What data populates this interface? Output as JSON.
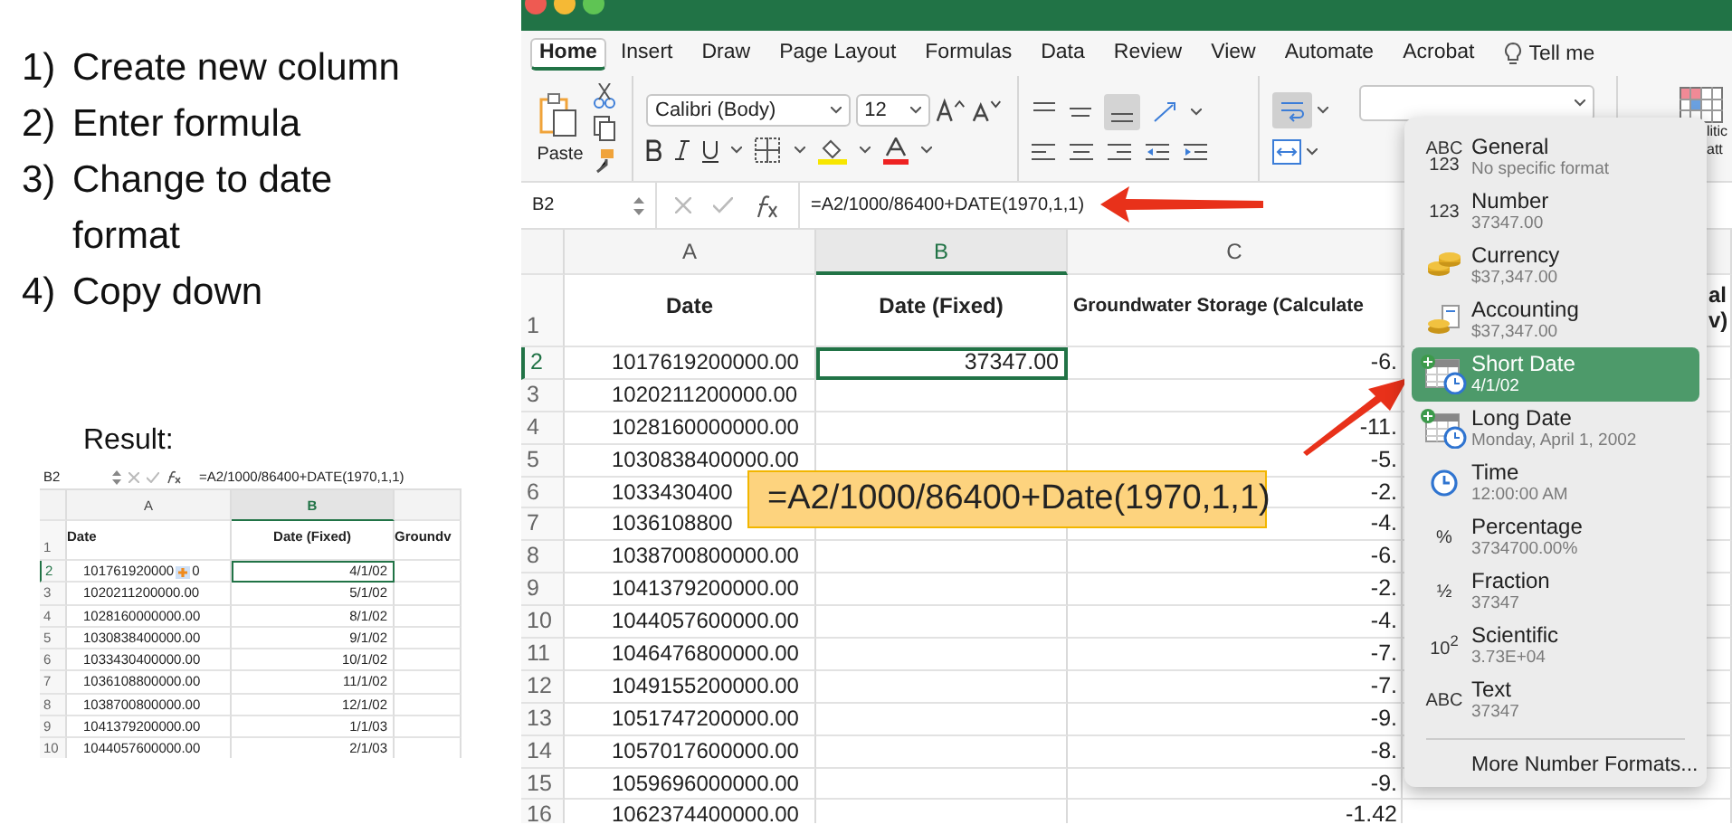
{
  "steps": [
    {
      "number": "1)",
      "text": "Create new column"
    },
    {
      "number": "2)",
      "text": "Enter formula"
    },
    {
      "number": "3)",
      "text": "Change to date format"
    },
    {
      "number": "4)",
      "text": "Copy down"
    }
  ],
  "result_label": "Result:",
  "result_sheet": {
    "name_box": "B2",
    "formula": "=A2/1000/86400+DATE(1970,1,1)",
    "columns": [
      {
        "label": "A",
        "selected": false
      },
      {
        "label": "B",
        "selected": true
      }
    ],
    "header_row": {
      "row": "1",
      "cells": [
        "Date",
        "Date (Fixed)",
        "Groundv"
      ]
    },
    "rows": [
      {
        "row": "2",
        "a": "101761920000",
        "a_tail": "0",
        "b": "4/1/02",
        "selected": true
      },
      {
        "row": "3",
        "a": "1020211200000.00",
        "b": "5/1/02",
        "selected": false
      },
      {
        "row": "4",
        "a": "1028160000000.00",
        "b": "8/1/02",
        "selected": false
      },
      {
        "row": "5",
        "a": "1030838400000.00",
        "b": "9/1/02",
        "selected": false
      },
      {
        "row": "6",
        "a": "1033430400000.00",
        "b": "10/1/02",
        "selected": false
      },
      {
        "row": "7",
        "a": "1036108800000.00",
        "b": "11/1/02",
        "selected": false
      },
      {
        "row": "8",
        "a": "1038700800000.00",
        "b": "12/1/02",
        "selected": false
      },
      {
        "row": "9",
        "a": "1041379200000.00",
        "b": "1/1/03",
        "selected": false
      },
      {
        "row": "10",
        "a": "1044057600000.00",
        "b": "2/1/03",
        "selected": false
      }
    ]
  },
  "excel": {
    "tabs": [
      {
        "label": "Home",
        "selected": true
      },
      {
        "label": "Insert",
        "selected": false
      },
      {
        "label": "Draw",
        "selected": false
      },
      {
        "label": "Page Layout",
        "selected": false
      },
      {
        "label": "Formulas",
        "selected": false
      },
      {
        "label": "Data",
        "selected": false
      },
      {
        "label": "Review",
        "selected": false
      },
      {
        "label": "View",
        "selected": false
      },
      {
        "label": "Automate",
        "selected": false
      },
      {
        "label": "Acrobat",
        "selected": false
      }
    ],
    "tell_me": "Tell me",
    "ribbon": {
      "paste_label": "Paste",
      "font_name": "Calibri (Body)",
      "font_size": "12",
      "conditional_formatting_fragment": [
        "litic",
        "att"
      ]
    },
    "formula_bar": {
      "name_box": "B2",
      "formula": "=A2/1000/86400+DATE(1970,1,1)"
    },
    "sheet": {
      "columns": [
        {
          "label": "A",
          "selected": false
        },
        {
          "label": "B",
          "selected": true
        },
        {
          "label": "C",
          "selected": false
        }
      ],
      "header_row": {
        "row": "1",
        "cells": [
          "Date",
          "Date (Fixed)",
          "Groundwater Storage (Calculate"
        ],
        "column_4_fragment": [
          "al",
          "v)"
        ]
      },
      "rows": [
        {
          "row": "2",
          "a": "1017619200000.00",
          "b": "37347.00",
          "c": "-6.",
          "selected": true
        },
        {
          "row": "3",
          "a": "1020211200000.00",
          "selected": false
        },
        {
          "row": "4",
          "a": "1028160000000.00",
          "c": "-11.",
          "selected": false
        },
        {
          "row": "5",
          "a": "1030838400000.00",
          "c": "-5.",
          "selected": false
        },
        {
          "row": "6",
          "a": "1033430400",
          "c": "-2.",
          "selected": false
        },
        {
          "row": "7",
          "a": "1036108800",
          "c": "-4.",
          "selected": false
        },
        {
          "row": "8",
          "a": "1038700800000.00",
          "c": "-6.",
          "selected": false
        },
        {
          "row": "9",
          "a": "1041379200000.00",
          "c": "-2.",
          "selected": false
        },
        {
          "row": "10",
          "a": "1044057600000.00",
          "c": "-4.",
          "selected": false
        },
        {
          "row": "11",
          "a": "1046476800000.00",
          "c": "-7.",
          "selected": false
        },
        {
          "row": "12",
          "a": "1049155200000.00",
          "c": "-7.",
          "selected": false
        },
        {
          "row": "13",
          "a": "1051747200000.00",
          "c": "-9.",
          "selected": false
        },
        {
          "row": "14",
          "a": "1057017600000.00",
          "c": "-8.",
          "selected": false
        },
        {
          "row": "15",
          "a": "1059696000000.00",
          "c": "-9.",
          "selected": false
        },
        {
          "row": "16",
          "a": "1062374400000.00",
          "c": "-1.42",
          "selected": false
        }
      ]
    },
    "callout": "=A2/1000/86400+Date(1970,1,1)",
    "number_format_menu": {
      "items": [
        {
          "kind": "general",
          "icon_text": "ABC 123",
          "name": "General",
          "example": "No specific format",
          "selected": false
        },
        {
          "kind": "number",
          "icon_text": "123",
          "name": "Number",
          "example": "37347.00",
          "selected": false
        },
        {
          "kind": "currency",
          "name": "Currency",
          "example": "$37,347.00",
          "selected": false
        },
        {
          "kind": "accounting",
          "name": "Accounting",
          "example": "$37,347.00",
          "selected": false
        },
        {
          "kind": "short_date",
          "name": "Short Date",
          "example": "4/1/02",
          "selected": true
        },
        {
          "kind": "long_date",
          "name": "Long Date",
          "example": "Monday, April 1, 2002",
          "selected": false
        },
        {
          "kind": "time",
          "name": "Time",
          "example": "12:00:00 AM",
          "selected": false
        },
        {
          "kind": "percentage",
          "icon_text": "%",
          "name": "Percentage",
          "example": "3734700.00%",
          "selected": false
        },
        {
          "kind": "fraction",
          "icon_text": "½",
          "name": "Fraction",
          "example": "37347",
          "selected": false
        },
        {
          "kind": "scientific",
          "icon_text": "10$^{2}$",
          "name": "Scientific",
          "example": "3.73E+04",
          "selected": false
        },
        {
          "kind": "text",
          "icon_text": "ABC",
          "name": "Text",
          "example": "37347",
          "selected": false
        }
      ],
      "more": "More Number Formats..."
    }
  }
}
